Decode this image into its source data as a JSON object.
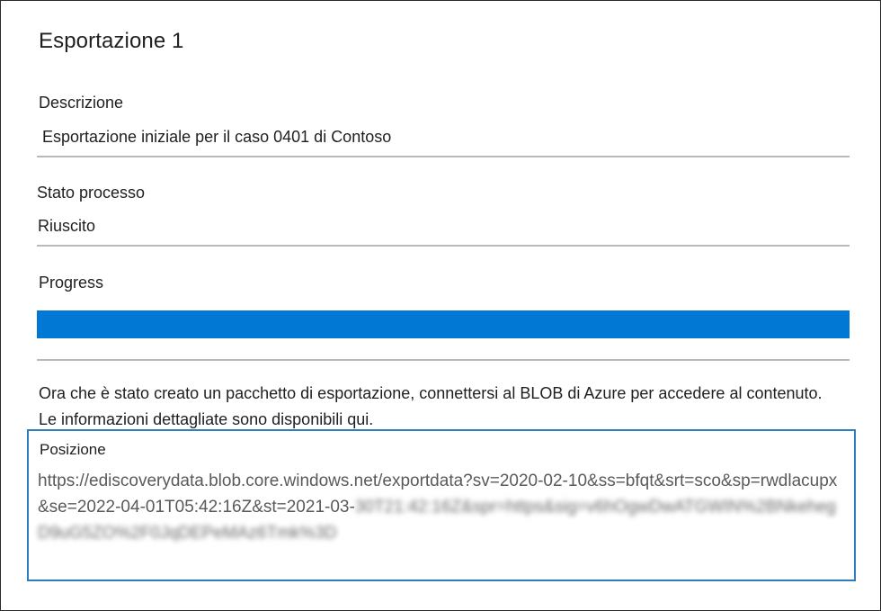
{
  "export": {
    "title": "Esportazione 1"
  },
  "description": {
    "label": "Descrizione",
    "value": "Esportazione iniziale per il caso 0401 di Contoso"
  },
  "status": {
    "label": "Stato processo",
    "value": "Riuscito"
  },
  "progress": {
    "label": "Progress",
    "percent": 100,
    "fill_color": "#0078d4"
  },
  "info_text": "Ora che è stato creato un pacchetto di esportazione, connettersi al BLOB di Azure per accedere al contenuto. Le informazioni dettagliate sono disponibili qui.",
  "location": {
    "label": "Posizione",
    "url_visible": "https://ediscoverydata.blob.core.windows.net/exportdata?sv=2020-02-10&ss=bfqt&srt=sco&sp=rwdlacupx&se=2022-04-01T05:42:16Z&st=2021-03-",
    "url_blurred": "30T21:42:16Z&spr=https&sig=v6hOgwDwATGWIN%2BNkehegD9uG5ZO%2F0JqDEPeMAz6Tmk%3D",
    "border_color": "#2f7dbd"
  }
}
